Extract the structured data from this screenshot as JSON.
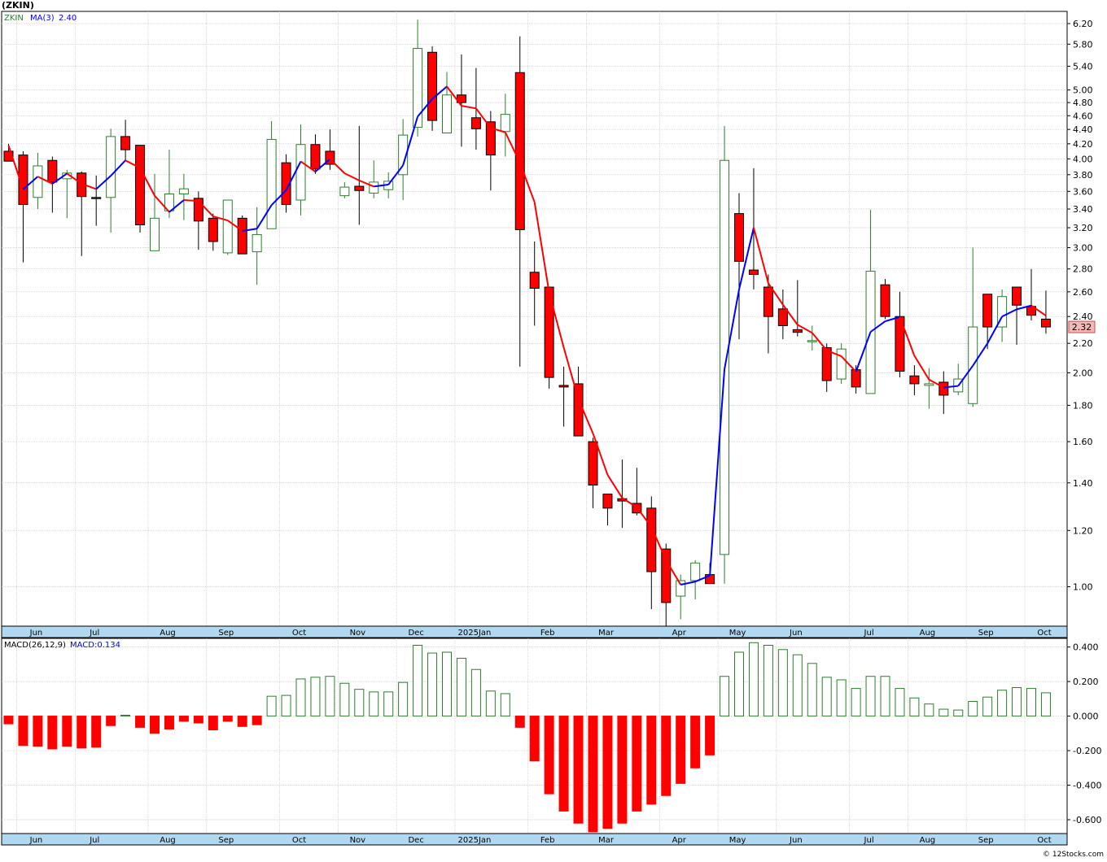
{
  "title": "(ZKIN)",
  "watermark": "© 12Stocks.com",
  "colors": {
    "up_candle": "#2e7d2e",
    "down_candle": "#ff0000",
    "ma_up": "#0000ff",
    "ma_down": "#ff0000",
    "grid": "#c8c8c8",
    "axis_band": "#b0d8f0",
    "price_tag": "#f4b8b8"
  },
  "chart_data": [
    {
      "type": "candlestick",
      "scale": "log",
      "legend_ticker": "ZKIN",
      "legend_ma": "MA(3)",
      "legend_ma_value": "2.40",
      "last_price_label": "2.32",
      "ylim": [
        0.88,
        6.45
      ],
      "y_ticks": [
        "1.00",
        "1.20",
        "1.40",
        "1.60",
        "1.80",
        "2.00",
        "2.20",
        "2.40",
        "2.60",
        "2.80",
        "3.00",
        "3.20",
        "3.40",
        "3.60",
        "3.80",
        "4.00",
        "4.20",
        "4.40",
        "4.60",
        "4.80",
        "5.00",
        "5.40",
        "5.80",
        "6.20"
      ],
      "x_labels": [
        "Jun",
        "Jul",
        "Aug",
        "Sep",
        "Oct",
        "Nov",
        "Dec",
        "2025Jan",
        "Feb",
        "Mar",
        "Apr",
        "May",
        "Jun",
        "Jul",
        "Aug",
        "Sep",
        "Oct"
      ],
      "x_label_bar_index": [
        1,
        5,
        10,
        14,
        19,
        23,
        27,
        31,
        36,
        40,
        45,
        49,
        53,
        58,
        62,
        66,
        70
      ],
      "bars": [
        {
          "o": 4.1,
          "h": 4.2,
          "l": 3.98,
          "c": 3.97
        },
        {
          "o": 4.05,
          "h": 4.1,
          "l": 2.86,
          "c": 3.45
        },
        {
          "o": 3.53,
          "h": 4.08,
          "l": 3.4,
          "c": 3.91
        },
        {
          "o": 3.98,
          "h": 4.03,
          "l": 3.36,
          "c": 3.71
        },
        {
          "o": 3.75,
          "h": 3.86,
          "l": 3.3,
          "c": 3.82
        },
        {
          "o": 3.82,
          "h": 3.84,
          "l": 2.92,
          "c": 3.54
        },
        {
          "o": 3.53,
          "h": 3.79,
          "l": 3.22,
          "c": 3.52
        },
        {
          "o": 3.53,
          "h": 4.41,
          "l": 3.15,
          "c": 4.3
        },
        {
          "o": 4.3,
          "h": 4.54,
          "l": 3.97,
          "c": 4.12
        },
        {
          "o": 4.18,
          "h": 4.18,
          "l": 3.15,
          "c": 3.23
        },
        {
          "o": 2.97,
          "h": 3.81,
          "l": 2.97,
          "c": 3.3
        },
        {
          "o": 3.38,
          "h": 4.12,
          "l": 3.3,
          "c": 3.57
        },
        {
          "o": 3.57,
          "h": 3.81,
          "l": 3.28,
          "c": 3.63
        },
        {
          "o": 3.52,
          "h": 3.6,
          "l": 2.98,
          "c": 3.27
        },
        {
          "o": 3.3,
          "h": 3.35,
          "l": 2.97,
          "c": 3.06
        },
        {
          "o": 2.95,
          "h": 3.45,
          "l": 2.93,
          "c": 3.5
        },
        {
          "o": 3.3,
          "h": 3.33,
          "l": 2.94,
          "c": 2.94
        },
        {
          "o": 2.96,
          "h": 3.42,
          "l": 2.66,
          "c": 3.13
        },
        {
          "o": 3.19,
          "h": 4.52,
          "l": 3.19,
          "c": 4.26
        },
        {
          "o": 3.95,
          "h": 4.06,
          "l": 3.36,
          "c": 3.45
        },
        {
          "o": 3.5,
          "h": 4.47,
          "l": 3.33,
          "c": 4.19
        },
        {
          "o": 4.19,
          "h": 4.33,
          "l": 3.81,
          "c": 3.87
        },
        {
          "o": 4.1,
          "h": 4.4,
          "l": 3.86,
          "c": 3.93
        },
        {
          "o": 3.55,
          "h": 3.71,
          "l": 3.52,
          "c": 3.65
        },
        {
          "o": 3.66,
          "h": 4.45,
          "l": 3.23,
          "c": 3.61
        },
        {
          "o": 3.58,
          "h": 3.98,
          "l": 3.52,
          "c": 3.71
        },
        {
          "o": 3.62,
          "h": 3.83,
          "l": 3.52,
          "c": 3.72
        },
        {
          "o": 3.8,
          "h": 4.55,
          "l": 3.5,
          "c": 4.32
        },
        {
          "o": 4.43,
          "h": 6.28,
          "l": 4.3,
          "c": 5.72
        },
        {
          "o": 5.65,
          "h": 5.76,
          "l": 4.38,
          "c": 4.53
        },
        {
          "o": 4.35,
          "h": 5.3,
          "l": 4.35,
          "c": 4.92
        },
        {
          "o": 4.92,
          "h": 5.61,
          "l": 4.16,
          "c": 4.8
        },
        {
          "o": 4.57,
          "h": 5.37,
          "l": 4.12,
          "c": 4.41
        },
        {
          "o": 4.51,
          "h": 4.67,
          "l": 3.61,
          "c": 4.05
        },
        {
          "o": 4.37,
          "h": 4.94,
          "l": 4.03,
          "c": 4.62
        },
        {
          "o": 5.29,
          "h": 5.95,
          "l": 2.04,
          "c": 3.18
        },
        {
          "o": 2.77,
          "h": 3.06,
          "l": 2.33,
          "c": 2.63
        },
        {
          "o": 2.64,
          "h": 2.64,
          "l": 1.9,
          "c": 1.97
        },
        {
          "o": 1.92,
          "h": 2.04,
          "l": 1.68,
          "c": 1.91
        },
        {
          "o": 1.93,
          "h": 2.04,
          "l": 1.63,
          "c": 1.63
        },
        {
          "o": 1.6,
          "h": 1.62,
          "l": 1.29,
          "c": 1.39
        },
        {
          "o": 1.35,
          "h": 1.35,
          "l": 1.22,
          "c": 1.29
        },
        {
          "o": 1.33,
          "h": 1.51,
          "l": 1.21,
          "c": 1.32
        },
        {
          "o": 1.31,
          "h": 1.47,
          "l": 1.26,
          "c": 1.27
        },
        {
          "o": 1.29,
          "h": 1.34,
          "l": 0.93,
          "c": 1.05
        },
        {
          "o": 1.13,
          "h": 1.15,
          "l": 0.88,
          "c": 0.95
        },
        {
          "o": 0.97,
          "h": 1.04,
          "l": 0.9,
          "c": 1.02
        },
        {
          "o": 1.02,
          "h": 1.09,
          "l": 0.96,
          "c": 1.08
        },
        {
          "o": 1.04,
          "h": 1.08,
          "l": 1.02,
          "c": 1.01
        },
        {
          "o": 1.11,
          "h": 4.45,
          "l": 1.01,
          "c": 3.98
        },
        {
          "o": 3.35,
          "h": 3.58,
          "l": 2.23,
          "c": 2.87
        },
        {
          "o": 2.79,
          "h": 3.88,
          "l": 2.62,
          "c": 2.75
        },
        {
          "o": 2.64,
          "h": 2.75,
          "l": 2.13,
          "c": 2.4
        },
        {
          "o": 2.46,
          "h": 2.62,
          "l": 2.23,
          "c": 2.33
        },
        {
          "o": 2.3,
          "h": 2.7,
          "l": 2.25,
          "c": 2.28
        },
        {
          "o": 2.22,
          "h": 2.33,
          "l": 2.15,
          "c": 2.22
        },
        {
          "o": 2.17,
          "h": 2.2,
          "l": 1.88,
          "c": 1.95
        },
        {
          "o": 1.96,
          "h": 2.2,
          "l": 1.93,
          "c": 2.16
        },
        {
          "o": 2.02,
          "h": 2.05,
          "l": 1.87,
          "c": 1.91
        },
        {
          "o": 1.87,
          "h": 3.39,
          "l": 1.87,
          "c": 2.78
        },
        {
          "o": 2.66,
          "h": 2.71,
          "l": 2.38,
          "c": 2.4
        },
        {
          "o": 2.4,
          "h": 2.6,
          "l": 1.97,
          "c": 2.01
        },
        {
          "o": 1.98,
          "h": 2.05,
          "l": 1.86,
          "c": 1.93
        },
        {
          "o": 1.92,
          "h": 2.03,
          "l": 1.78,
          "c": 1.93
        },
        {
          "o": 1.94,
          "h": 2.01,
          "l": 1.75,
          "c": 1.86
        },
        {
          "o": 1.88,
          "h": 2.06,
          "l": 1.86,
          "c": 1.96
        },
        {
          "o": 1.81,
          "h": 3.0,
          "l": 1.79,
          "c": 2.32
        },
        {
          "o": 2.58,
          "h": 2.58,
          "l": 2.16,
          "c": 2.32
        },
        {
          "o": 2.32,
          "h": 2.62,
          "l": 2.21,
          "c": 2.56
        },
        {
          "o": 2.64,
          "h": 2.64,
          "l": 2.19,
          "c": 2.49
        },
        {
          "o": 2.48,
          "h": 2.8,
          "l": 2.37,
          "c": 2.41
        },
        {
          "o": 2.38,
          "h": 2.61,
          "l": 2.27,
          "c": 2.32
        }
      ]
    },
    {
      "type": "bar",
      "legend_label": "MACD(26,12,9)",
      "legend_value": "MACD:0.134",
      "ylim": [
        -0.68,
        0.45
      ],
      "y_ticks": [
        "0.400",
        "0.200",
        "0.000",
        "-0.200",
        "-0.400",
        "-0.600"
      ],
      "x_labels": [
        "Jun",
        "Jul",
        "Aug",
        "Sep",
        "Oct",
        "Nov",
        "Dec",
        "2025Jan",
        "Feb",
        "Mar",
        "Apr",
        "May",
        "Jun",
        "Jul",
        "Aug",
        "Sep",
        "Oct"
      ],
      "values": [
        -0.045,
        -0.17,
        -0.175,
        -0.19,
        -0.175,
        -0.185,
        -0.18,
        -0.055,
        0.005,
        -0.065,
        -0.1,
        -0.075,
        -0.03,
        -0.04,
        -0.08,
        -0.03,
        -0.06,
        -0.05,
        0.115,
        0.12,
        0.215,
        0.225,
        0.23,
        0.19,
        0.155,
        0.14,
        0.14,
        0.195,
        0.41,
        0.365,
        0.37,
        0.335,
        0.27,
        0.145,
        0.13,
        -0.065,
        -0.26,
        -0.45,
        -0.55,
        -0.62,
        -0.67,
        -0.65,
        -0.62,
        -0.55,
        -0.51,
        -0.46,
        -0.39,
        -0.3,
        -0.225,
        0.23,
        0.37,
        0.425,
        0.41,
        0.385,
        0.355,
        0.305,
        0.225,
        0.21,
        0.16,
        0.23,
        0.23,
        0.16,
        0.105,
        0.07,
        0.04,
        0.035,
        0.085,
        0.11,
        0.15,
        0.165,
        0.16,
        0.135
      ]
    }
  ]
}
